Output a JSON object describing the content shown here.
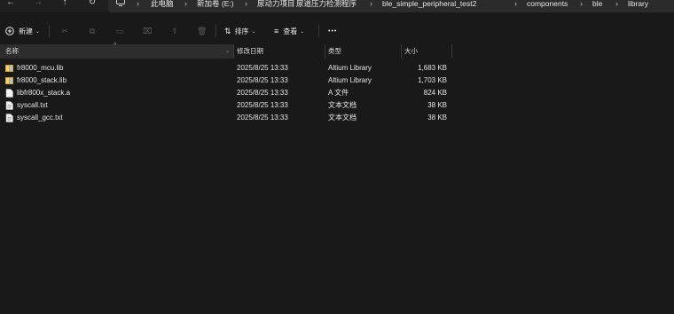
{
  "address": {
    "crumbs": [
      "此电脑",
      "新加卷 (E:)",
      "尿动力项目",
      "尿道压力检测程序",
      "ble_simple_peripheral_test2",
      "components",
      "ble",
      "library"
    ]
  },
  "toolbar": {
    "new_label": "新建",
    "sort_label": "排序",
    "view_label": "查看",
    "more_label": "•••"
  },
  "columns": {
    "name": "名称",
    "date": "修改日期",
    "type": "类型",
    "size": "大小"
  },
  "files": [
    {
      "name": "fr8000_mcu.lib",
      "date": "2025/8/25 13:33",
      "type": "Altium Library",
      "size": "1,683 KB",
      "icon": "library-file-icon"
    },
    {
      "name": "fr8000_stack.lib",
      "date": "2025/8/25 13:33",
      "type": "Altium Library",
      "size": "1,703 KB",
      "icon": "library-file-icon"
    },
    {
      "name": "libfr800x_stack.a",
      "date": "2025/8/25 13:33",
      "type": "A 文件",
      "size": "824 KB",
      "icon": "blank-file-icon"
    },
    {
      "name": "syscall.txt",
      "date": "2025/8/25 13:33",
      "type": "文本文档",
      "size": "38 KB",
      "icon": "text-file-icon"
    },
    {
      "name": "syscall_gcc.txt",
      "date": "2025/8/25 13:33",
      "type": "文本文档",
      "size": "38 KB",
      "icon": "text-file-icon"
    }
  ]
}
